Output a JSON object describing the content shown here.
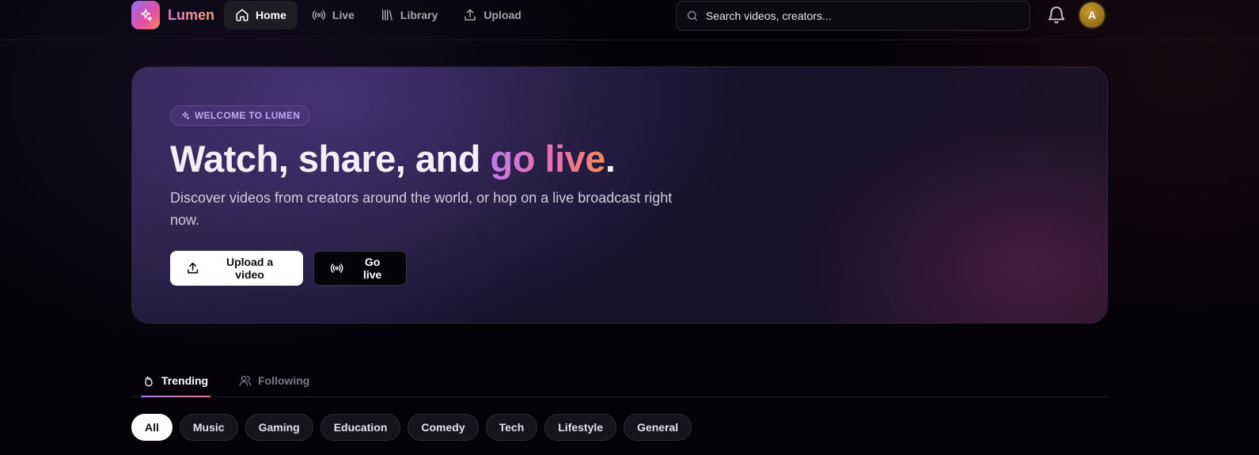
{
  "app": {
    "name": "Lumen"
  },
  "nav": [
    {
      "label": "Home",
      "icon": "home-icon",
      "active": true
    },
    {
      "label": "Live",
      "icon": "broadcast-icon",
      "active": false
    },
    {
      "label": "Library",
      "icon": "library-icon",
      "active": false
    },
    {
      "label": "Upload",
      "icon": "upload-icon",
      "active": false
    }
  ],
  "search": {
    "placeholder": "Search videos, creators..."
  },
  "user": {
    "avatar_initial": "A"
  },
  "hero": {
    "badge": "WELCOME TO LUMEN",
    "headline_main": "Watch, share, and ",
    "headline_highlight": "go live",
    "headline_end": ".",
    "subtext": "Discover videos from creators around the world, or hop on a live broadcast right now.",
    "upload_button": "Upload a video",
    "live_button": "Go live"
  },
  "tabs": [
    {
      "label": "Trending",
      "icon": "flame-icon",
      "active": true
    },
    {
      "label": "Following",
      "icon": "users-icon",
      "active": false
    }
  ],
  "categories": {
    "selected": "All",
    "items": [
      "All",
      "Music",
      "Gaming",
      "Education",
      "Comedy",
      "Tech",
      "Lifestyle",
      "General"
    ]
  },
  "colors": {
    "accent_purple": "#a67ef0",
    "accent_pink": "#ef6fa8",
    "accent_orange": "#f48a5a",
    "background": "#050308"
  }
}
